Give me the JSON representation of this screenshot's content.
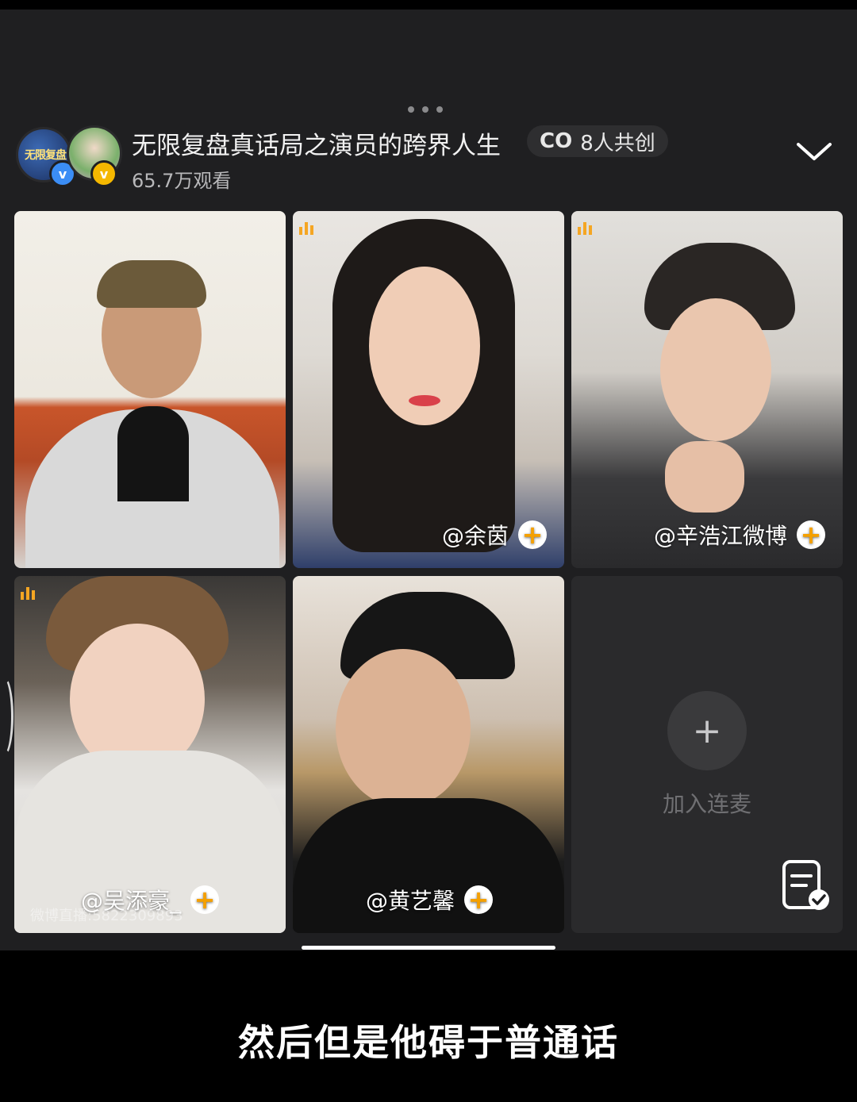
{
  "header": {
    "title": "无限复盘真话局之演员的跨界人生",
    "cocreate_icon": "CO",
    "cocreate_label": "8人共创",
    "viewers": "65.7万观看",
    "avatar1_text": "无限复盘",
    "verified_mark": "v"
  },
  "tiles": [
    {
      "name": ""
    },
    {
      "name": "@余茵"
    },
    {
      "name": "@辛浩江微博"
    },
    {
      "name": "@吴添豪_",
      "watermark": "微博直播:5822309893"
    },
    {
      "name": "@黄艺馨"
    }
  ],
  "join": {
    "plus": "+",
    "label": "加入连麦"
  },
  "follow_plus": "+",
  "subtitle": "然后但是他碍于普通话",
  "colors": {
    "accent": "#f5a623",
    "background": "#1f1f21"
  }
}
